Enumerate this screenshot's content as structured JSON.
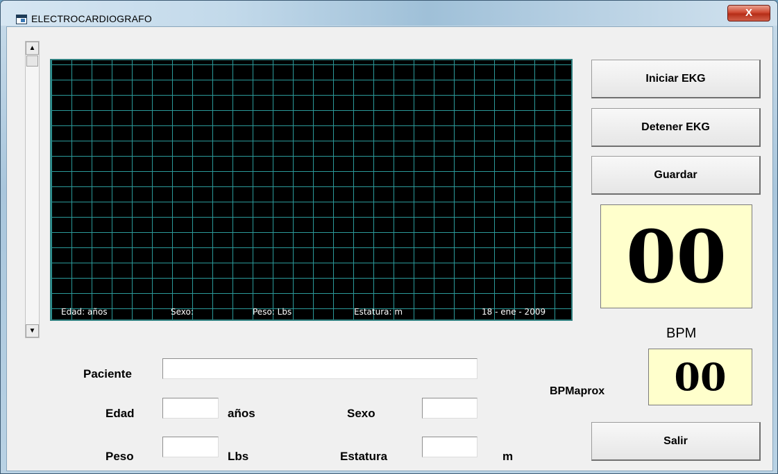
{
  "window": {
    "title": "ELECTROCARDIOGRAFO",
    "close_label": "X"
  },
  "scope": {
    "edad_label": "Edad: años",
    "sexo_label": "Sexo:",
    "peso_label": "Peso: Lbs",
    "estatura_label": "Estatura: m",
    "date": "18 - ene - 2009"
  },
  "buttons": {
    "iniciar": "Iniciar EKG",
    "detener": "Detener EKG",
    "guardar": "Guardar",
    "salir": "Salir"
  },
  "display": {
    "bpm_value": "00",
    "bpm_label": "BPM",
    "bpmaprox_label": "BPMaprox",
    "bpmaprox_value": "00"
  },
  "form": {
    "paciente_label": "Paciente",
    "paciente_value": "",
    "edad_label": "Edad",
    "edad_value": "",
    "edad_unit": "años",
    "sexo_label": "Sexo",
    "sexo_value": "",
    "peso_label": "Peso",
    "peso_value": "",
    "peso_unit": "Lbs",
    "estatura_label": "Estatura",
    "estatura_value": "",
    "estatura_unit": "m"
  },
  "icons": {
    "app": "app-window-icon",
    "scroll_up": "arrow-up-icon",
    "scroll_down": "arrow-down-icon"
  },
  "colors": {
    "scope_background": "#000000",
    "scope_grid": "#2b9a9a",
    "display_background": "#ffffcc"
  }
}
